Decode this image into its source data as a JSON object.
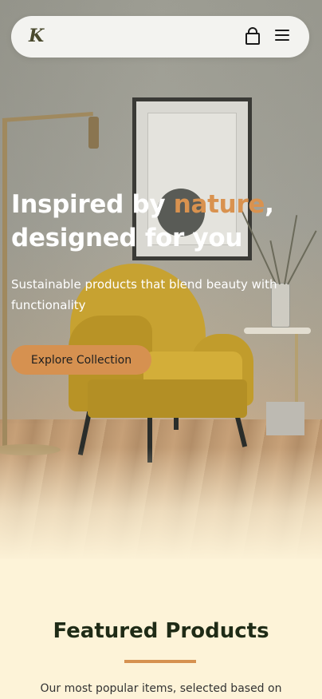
{
  "nav": {
    "logo_text": "K",
    "cart_icon": "shopping-bag-icon",
    "menu_icon": "hamburger-menu-icon"
  },
  "hero": {
    "headline_part1": "Inspired by ",
    "headline_accent": "nature",
    "headline_part2": ",",
    "headline_line2": "designed for you",
    "subheadline": "Sustainable products that blend beauty with functionality",
    "cta_label": "Explore Collection"
  },
  "featured": {
    "title": "Featured Products",
    "subtitle": "Our most popular items, selected based on"
  },
  "colors": {
    "accent": "#d69150",
    "heading_dark": "#1f2b16",
    "section_bg": "#fdf3d8"
  }
}
